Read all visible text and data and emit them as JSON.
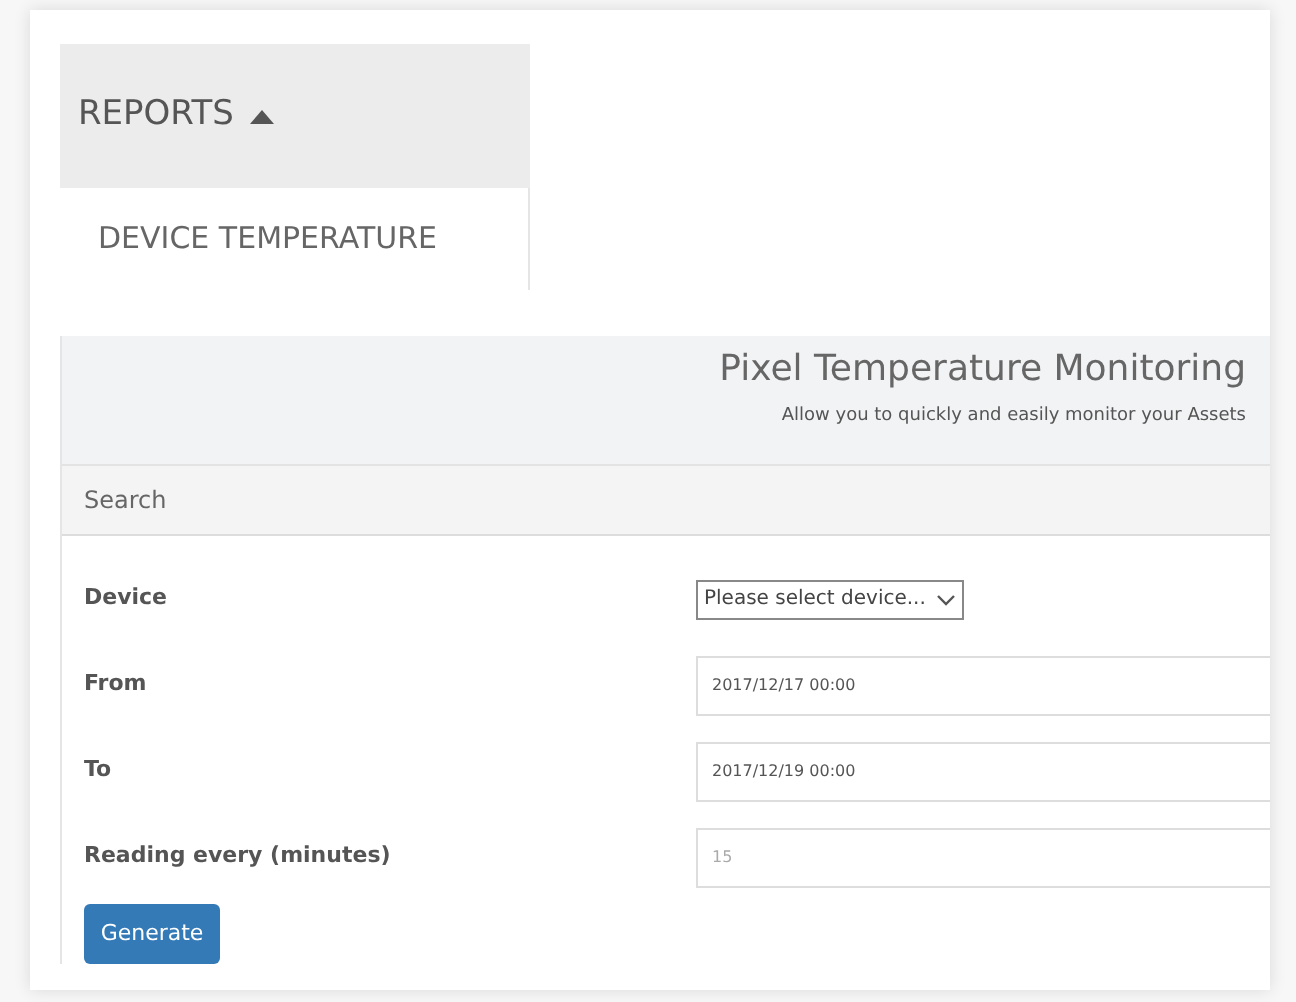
{
  "menu": {
    "title": "REPORTS",
    "expanded": true,
    "items": [
      {
        "label": "DEVICE TEMPERATURE"
      }
    ]
  },
  "panel": {
    "title": "Pixel Temperature Monitoring",
    "subtitle": "Allow you to quickly and easily monitor your Assets",
    "section": "Search",
    "fields": [
      {
        "kind": "select",
        "label": "Device",
        "value": "Please select device..."
      },
      {
        "kind": "text",
        "label": "From",
        "value": "2017/12/17 00:00"
      },
      {
        "kind": "text",
        "label": "To",
        "value": "2017/12/19 00:00"
      },
      {
        "kind": "text",
        "label": "Reading every (minutes)",
        "placeholder": "15"
      }
    ],
    "button": "Generate"
  }
}
